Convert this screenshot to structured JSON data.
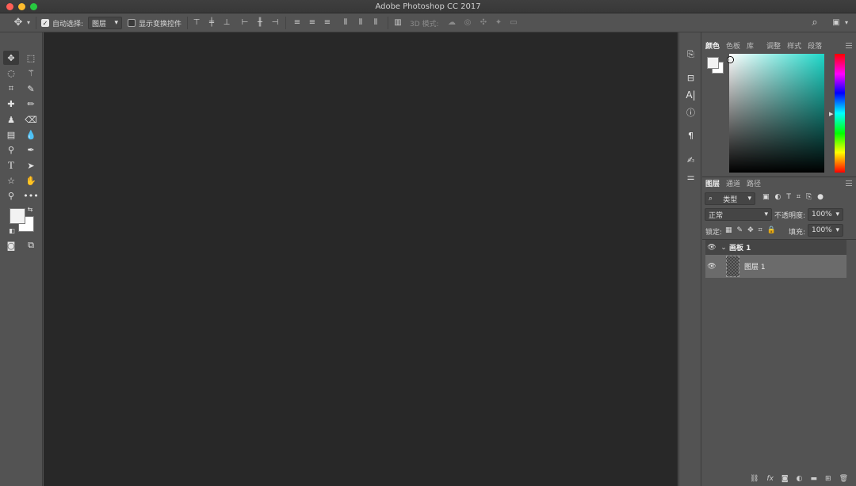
{
  "window": {
    "title": "Adobe Photoshop CC 2017"
  },
  "options_bar": {
    "auto_select_label": "自动选择:",
    "auto_select_checked": true,
    "auto_select_target": "图层",
    "show_transform_label": "显示变换控件",
    "show_transform_checked": false,
    "mode_3d_label": "3D 模式:"
  },
  "color_panel": {
    "tabs": [
      "颜色",
      "色板",
      "库",
      "调整",
      "样式",
      "段落"
    ],
    "active_tab": "颜色",
    "foreground": "#f2f2f2",
    "background": "#ffffff",
    "hue_color": "#1fd8c9"
  },
  "layers_panel": {
    "tabs": [
      "图层",
      "通道",
      "路径"
    ],
    "filter_label": "类型",
    "blend_mode": "正常",
    "opacity_label": "不透明度:",
    "opacity_value": "100%",
    "lock_label": "锁定:",
    "fill_label": "填充:",
    "fill_value": "100%",
    "artboard_name": "画板 1",
    "layer_name": "图层 1"
  },
  "icons": {
    "filter": "⌕",
    "check": "✓",
    "chevron": "⌄",
    "eye": "👁",
    "fx": "fx"
  }
}
